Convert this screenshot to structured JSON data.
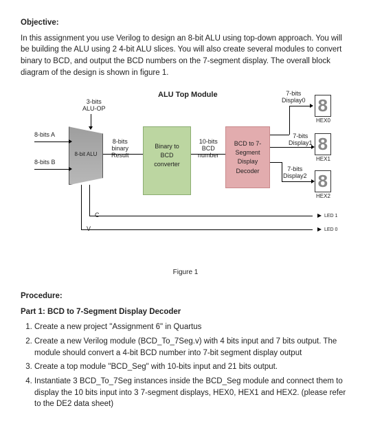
{
  "objective": {
    "heading": "Objective:",
    "text": "In this assignment you use Verilog to design an 8-bit ALU using top-down approach. You will be building the ALU using 2 4-bit ALU slices. You will also create several modules to convert binary to BCD, and output the BCD numbers on the 7-segment display.  The overall block diagram of the design is shown in figure 1."
  },
  "diagram": {
    "title": "ALU Top Module",
    "labels": {
      "aluop": "3-bits\nALU-OP",
      "a": "8-bits A",
      "b": "8-bits B",
      "alu": "8-bit ALU",
      "binres": "8-bits\nbinary\nResult",
      "bin2bcd": "Binary to\nBCD\nconverter",
      "bcdnum": "10-bits\nBCD\nnumber",
      "bcddec": "BCD to 7-\nSegment\nDisplay\nDecoder",
      "disp0": "7-bits\nDisplay0",
      "disp1": "7-bits\nDisplay1",
      "disp2": "7-bits\nDisplay2",
      "hex0": "HEX0",
      "hex1": "HEX1",
      "hex2": "HEX2",
      "c": "C",
      "v": "V",
      "led1": "LED 1",
      "led0": "LED 0"
    },
    "caption": "Figure 1"
  },
  "procedure": {
    "heading": "Procedure:",
    "part1": "Part 1: BCD to 7-Segment Display Decoder",
    "steps": [
      "Create a new project \"Assignment 6\" in Quartus",
      "Create a new Verilog module (BCD_To_7Seg.v) with 4 bits input and 7 bits output. The module should convert a 4-bit BCD number into 7-bit segment display output",
      "Create a top module \"BCD_Seg\" with 10-bits input and 21 bits output.",
      "Instantiate 3 BCD_To_7Seg instances inside the BCD_Seg module and connect them to display the 10 bits input into 3 7-segment displays, HEX0, HEX1 and HEX2. (please refer to the DE2 data sheet)"
    ]
  }
}
